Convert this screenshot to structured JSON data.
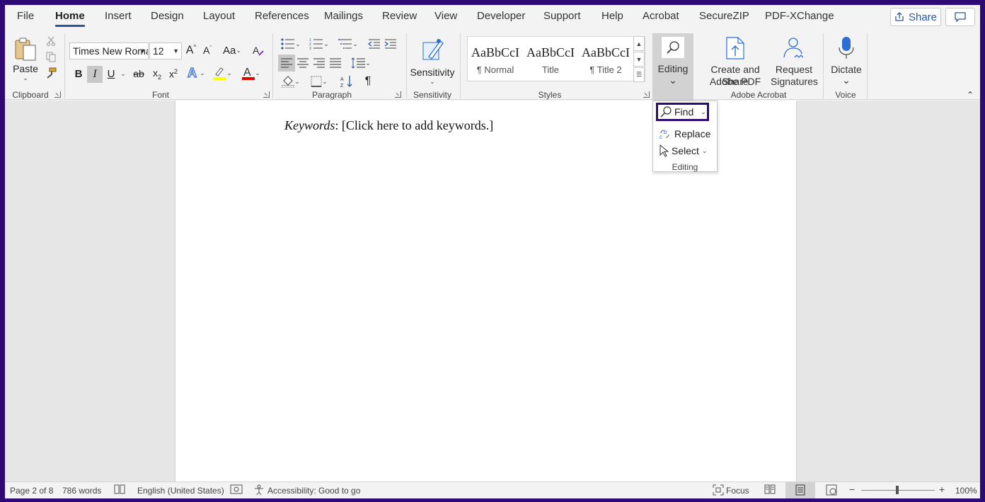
{
  "tabs": [
    "File",
    "Home",
    "Insert",
    "Design",
    "Layout",
    "References",
    "Mailings",
    "Review",
    "View",
    "Developer",
    "Support",
    "Help",
    "Acrobat",
    "SecureZIP",
    "PDF-XChange"
  ],
  "active_tab": "Home",
  "share_label": "Share",
  "ribbon": {
    "clipboard": {
      "label": "Clipboard",
      "paste": "Paste"
    },
    "font": {
      "label": "Font",
      "font_name": "Times New Roma",
      "font_size": "12",
      "case_btn": "Aa",
      "bold": "B",
      "italic": "I",
      "underline": "U",
      "strike": "ab"
    },
    "paragraph": {
      "label": "Paragraph"
    },
    "sensitivity": {
      "label": "Sensitivity",
      "button": "Sensitivity"
    },
    "styles": {
      "label": "Styles",
      "items": [
        {
          "sample": "AaBbCcI",
          "name": "¶ Normal"
        },
        {
          "sample": "AaBbCcI",
          "name": "Title"
        },
        {
          "sample": "AaBbCcI",
          "name": "¶ Title 2"
        }
      ]
    },
    "editing": {
      "button": "Editing"
    },
    "adobe": {
      "label": "Adobe Acrobat",
      "create_line1": "Create and Share",
      "create_line2": "Adobe PDF",
      "request_line1": "Request",
      "request_line2": "Signatures"
    },
    "voice": {
      "label": "Voice",
      "dictate": "Dictate"
    }
  },
  "dropdown": {
    "find": "Find",
    "replace": "Replace",
    "select": "Select",
    "footer": "Editing"
  },
  "document": {
    "keywords_label": "Keywords",
    "keywords_text": ":  [Click here to add keywords.]"
  },
  "status": {
    "page": "Page 2 of 8",
    "words": "786 words",
    "language": "English (United States)",
    "accessibility": "Accessibility: Good to go",
    "focus": "Focus",
    "zoom": "100%"
  },
  "colors": {
    "accent": "#2b579a",
    "frame": "#2e0a76",
    "highlight": "#ffff00",
    "font_color": "#e00000"
  }
}
